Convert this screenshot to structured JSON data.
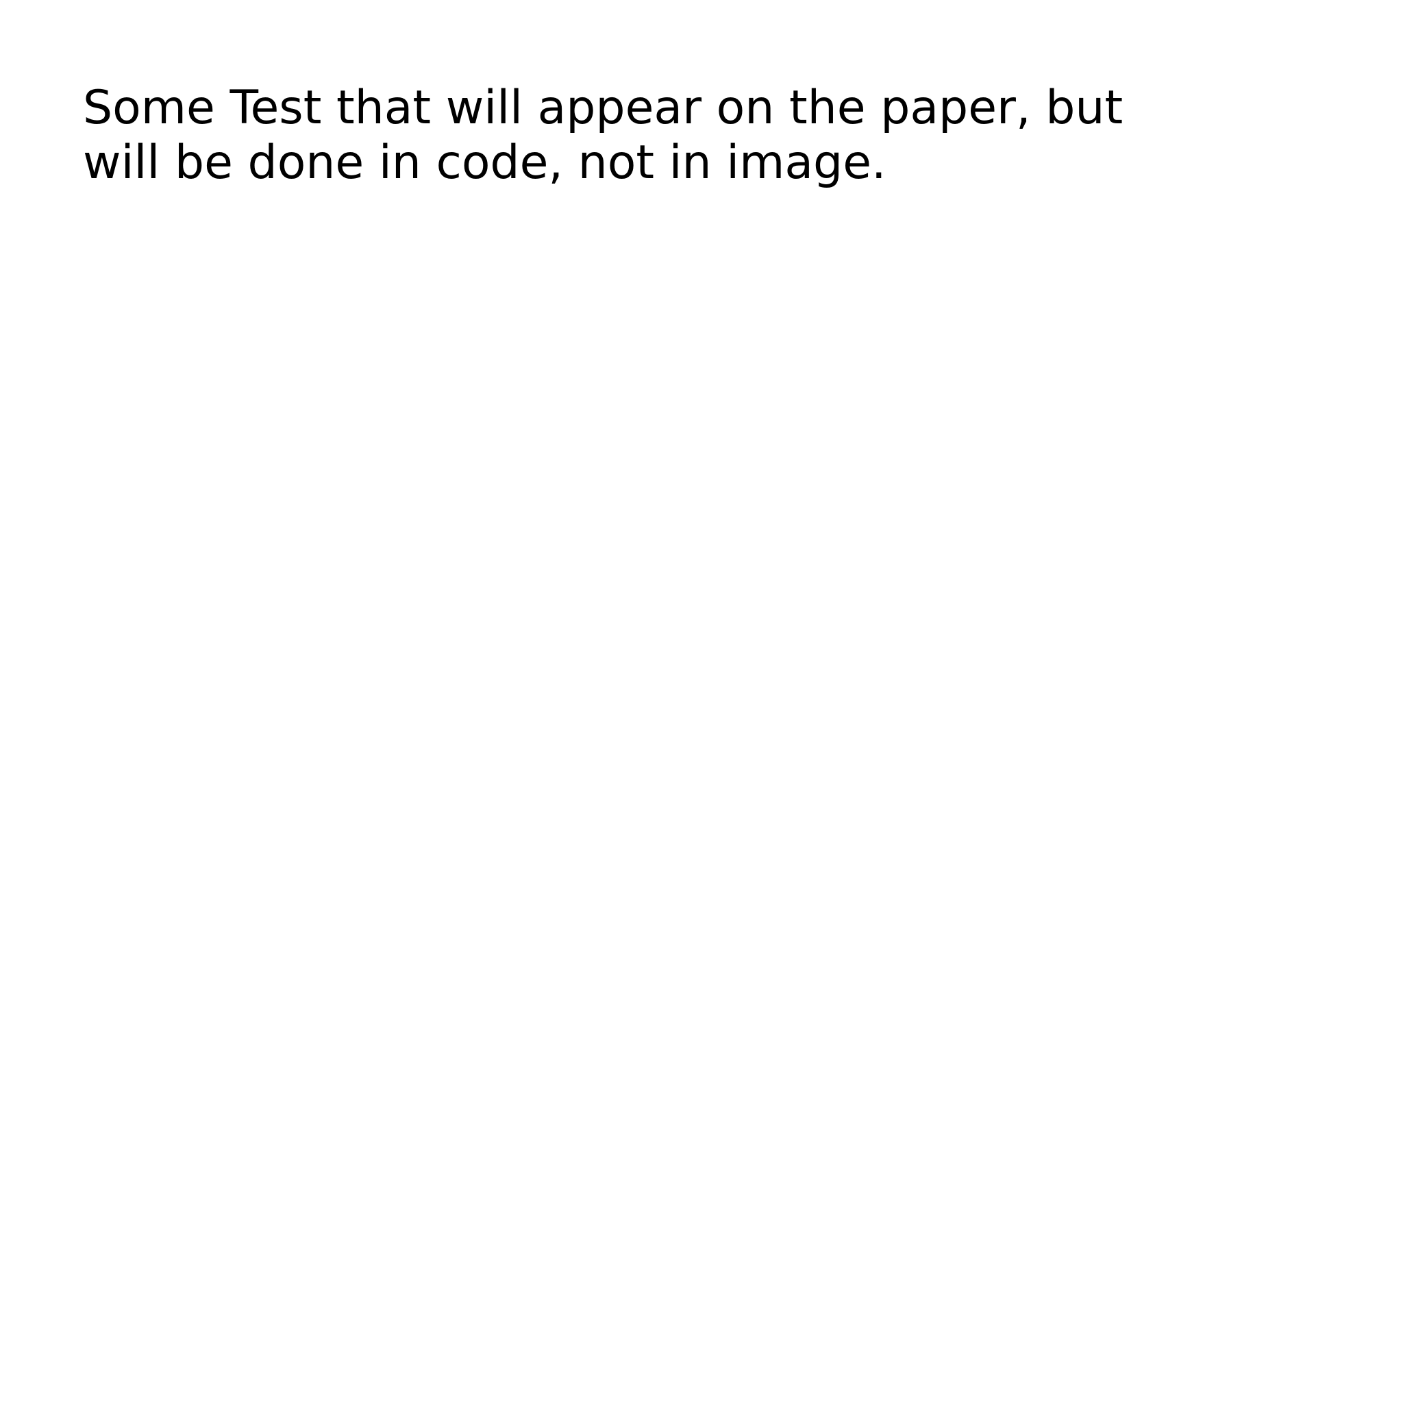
{
  "document": {
    "lines": [
      "Some Test that will appear on the paper, but",
      "will be done in code, not in image."
    ]
  },
  "colors": {
    "background": "#ffffff",
    "text": "#000000"
  }
}
